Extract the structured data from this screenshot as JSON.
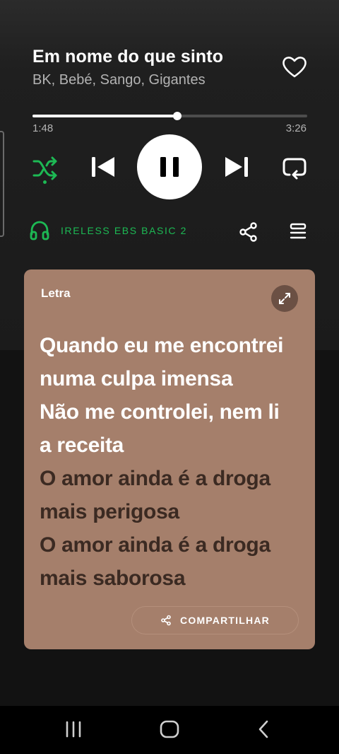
{
  "track": {
    "title": "Em nome do que sinto",
    "artists": "BK, Bebé, Sango, Gigantes"
  },
  "playback": {
    "elapsed": "1:48",
    "total": "3:26",
    "progress_fraction": 0.528,
    "state": "playing"
  },
  "device": {
    "name": "IRELESS EBS BASIC 2"
  },
  "lyrics": {
    "label": "Letra",
    "lines": [
      {
        "text": "Quando eu me encontrei",
        "state": "active"
      },
      {
        "text": "numa culpa imensa",
        "state": "active"
      },
      {
        "text": "Não me controlei, nem li",
        "state": "active"
      },
      {
        "text": "a receita",
        "state": "active"
      },
      {
        "text": "O amor ainda é a droga",
        "state": "upcoming"
      },
      {
        "text": "mais perigosa",
        "state": "upcoming"
      },
      {
        "text": "O amor ainda é a droga",
        "state": "upcoming"
      },
      {
        "text": "mais saborosa",
        "state": "upcoming"
      }
    ],
    "share_label": "COMPARTILHAR"
  },
  "colors": {
    "accent": "#1db954",
    "card": "#a57f6b",
    "upcoming_text": "#3b2a22"
  },
  "icons": {
    "like": "heart-icon",
    "shuffle": "shuffle-icon",
    "previous": "skip-previous-icon",
    "pause": "pause-icon",
    "next": "skip-next-icon",
    "repeat": "repeat-icon",
    "device": "headphones-icon",
    "share": "share-icon",
    "queue": "queue-icon",
    "expand": "expand-icon",
    "nav_recent": "recent-apps-icon",
    "nav_home": "home-icon",
    "nav_back": "back-icon"
  }
}
